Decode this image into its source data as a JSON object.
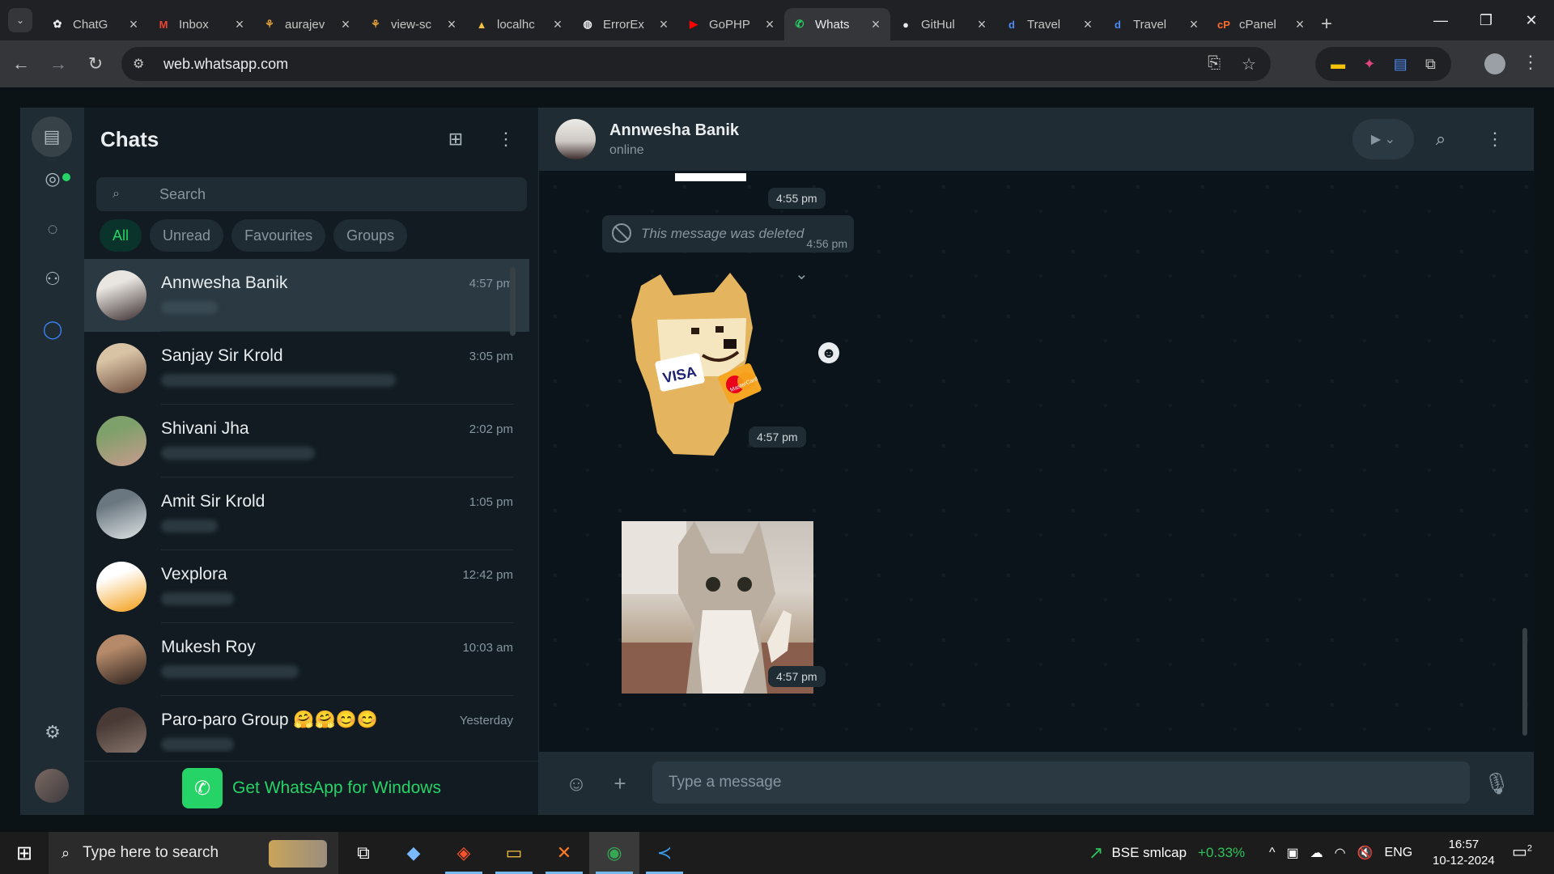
{
  "browser": {
    "tabs": [
      {
        "label": "ChatG",
        "icon": "chatgpt-icon",
        "active": false
      },
      {
        "label": "Inbox",
        "icon": "gmail-icon",
        "active": false
      },
      {
        "label": "aurajev",
        "icon": "knot-icon",
        "active": false
      },
      {
        "label": "view-sc",
        "icon": "knot-icon",
        "active": false
      },
      {
        "label": "localhc",
        "icon": "localhost-icon",
        "active": false
      },
      {
        "label": "ErrorEx",
        "icon": "globe-icon",
        "active": false
      },
      {
        "label": "GoPHP",
        "icon": "youtube-icon",
        "active": false
      },
      {
        "label": "Whats",
        "icon": "whatsapp-icon",
        "active": true
      },
      {
        "label": "GitHul",
        "icon": "github-icon",
        "active": false
      },
      {
        "label": "Travel",
        "icon": "d-icon",
        "active": false
      },
      {
        "label": "Travel",
        "icon": "d-icon",
        "active": false
      },
      {
        "label": "cPanel",
        "icon": "cpanel-icon",
        "active": false
      }
    ],
    "url": "web.whatsapp.com"
  },
  "sidebar": {
    "title": "Chats",
    "search_placeholder": "Search",
    "filters": [
      "All",
      "Unread",
      "Favourites",
      "Groups"
    ],
    "active_filter": "All",
    "chats": [
      {
        "name": "Annwesha Banik",
        "time": "4:57 pm",
        "selected": true,
        "avatar_colors": [
          "#e9e6e1",
          "#3b2e2e"
        ]
      },
      {
        "name": "Sanjay Sir Krold",
        "time": "3:05 pm",
        "selected": false,
        "avatar_colors": [
          "#d8c3a5",
          "#6b4a3a"
        ]
      },
      {
        "name": "Shivani Jha",
        "time": "2:02 pm",
        "selected": false,
        "avatar_colors": [
          "#7ea06a",
          "#c99b8d"
        ]
      },
      {
        "name": "Amit Sir Krold",
        "time": "1:05 pm",
        "selected": false,
        "avatar_colors": [
          "#6b7780",
          "#dfe5e7"
        ]
      },
      {
        "name": "Vexplora",
        "time": "12:42 pm",
        "selected": false,
        "avatar_colors": [
          "#ffffff",
          "#f39c12"
        ]
      },
      {
        "name": "Mukesh Roy",
        "time": "10:03 am",
        "selected": false,
        "avatar_colors": [
          "#b58a6a",
          "#2a1f1c"
        ]
      },
      {
        "name": "Paro-paro Group 🤗🤗😊😊",
        "time": "Yesterday",
        "selected": false,
        "avatar_colors": [
          "#4a3a36",
          "#8a7a70"
        ]
      }
    ],
    "get_app_label": "Get WhatsApp for Windows"
  },
  "conversation": {
    "contact_name": "Annwesha Banik",
    "contact_status": "online",
    "messages": {
      "time_1": "4:55 pm",
      "deleted_text": "This message was deleted",
      "deleted_time": "4:56 pm",
      "time_2": "4:57 pm",
      "time_3": "4:57 pm",
      "sticker_badge_1": "VISA",
      "sticker_badge_2": "MasterCard"
    },
    "input_placeholder": "Type a message"
  },
  "taskbar": {
    "search_placeholder": "Type here to search",
    "stock_name": "BSE smlcap",
    "stock_change": "+0.33%",
    "language": "ENG",
    "time": "16:57",
    "date": "10-12-2024",
    "notification_count": "2"
  },
  "colors": {
    "accent": "#25d366",
    "panel": "#111b21",
    "header": "#202c33",
    "selected": "#2a3942"
  }
}
